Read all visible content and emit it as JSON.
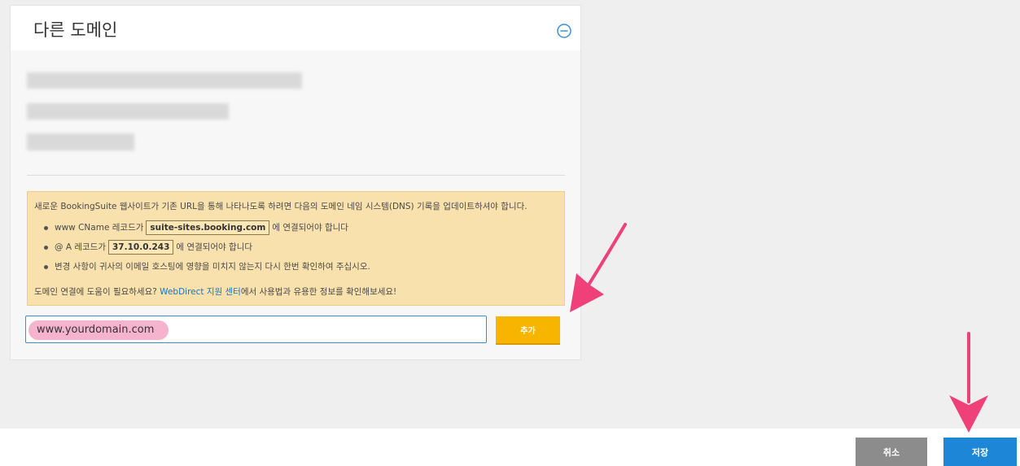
{
  "panel": {
    "title": "다른 도메인",
    "collapse_icon": "minus-circle-icon"
  },
  "notice": {
    "intro": "새로운 BookingSuite 웹사이트가 기존 URL을 통해 나타나도록 하려면 다음의 도메인 네임 시스템(DNS) 기록을 업데이트하셔야 합니다.",
    "items": [
      {
        "prefix": "www CName 레코드가",
        "code": "suite-sites.booking.com",
        "suffix": "에 연결되어야 합니다"
      },
      {
        "prefix": "@ A 레코드가",
        "code": "37.10.0.243",
        "suffix": "에 연결되어야 합니다"
      },
      {
        "text": "변경 사항이 귀사의 이메일 호스팅에 영향을 미치지 않는지 다시 한번 확인하여 주십시오."
      }
    ],
    "help_prefix": "도메인 연결에 도움이 필요하세요?",
    "help_link": "WebDirect 지원 센터",
    "help_suffix": "에서 사용법과 유용한 정보를 확인해보세요!"
  },
  "domain_input": {
    "value": "www.yourdomain.com"
  },
  "buttons": {
    "add": "추가",
    "cancel": "취소",
    "save": "저장"
  },
  "colors": {
    "arrow": "#f0407a",
    "add_button": "#f7b500",
    "save_button": "#1e86d6",
    "cancel_button": "#8c8c8c",
    "notice_bg": "#f8e1ac"
  }
}
